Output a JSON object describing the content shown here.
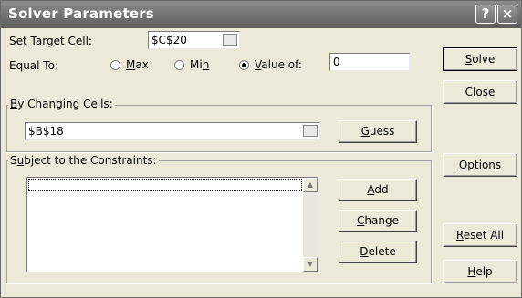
{
  "window": {
    "title": "Solver Parameters",
    "help_glyph": "?",
    "close_glyph": "×"
  },
  "target": {
    "label_pre": "S",
    "label_key": "e",
    "label_post": "t Target Cell:",
    "value": "$C$20"
  },
  "equal_to": {
    "label": "Equal To:",
    "max_pre": "",
    "max_key": "M",
    "max_post": "ax",
    "min_pre": "Mi",
    "min_key": "n",
    "min_post": "",
    "value_of_pre": "",
    "value_of_key": "V",
    "value_of_post": "alue of:",
    "selected": "value_of",
    "value": "0"
  },
  "changing": {
    "legend_pre": "",
    "legend_key": "B",
    "legend_post": "y Changing Cells:",
    "value": "$B$18",
    "guess_pre": "",
    "guess_key": "G",
    "guess_post": "uess"
  },
  "constraints": {
    "legend_pre": "S",
    "legend_key": "u",
    "legend_post": "bject to the Constraints:",
    "items": [],
    "add_pre": "",
    "add_key": "A",
    "add_post": "dd",
    "change_pre": "",
    "change_key": "C",
    "change_post": "hange",
    "delete_pre": "",
    "delete_key": "D",
    "delete_post": "elete"
  },
  "side_buttons": {
    "solve_pre": "",
    "solve_key": "S",
    "solve_post": "olve",
    "close": "Close",
    "options_pre": "",
    "options_key": "O",
    "options_post": "ptions",
    "reset_pre": "",
    "reset_key": "R",
    "reset_post": "eset All",
    "help_pre": "",
    "help_key": "H",
    "help_post": "elp"
  }
}
